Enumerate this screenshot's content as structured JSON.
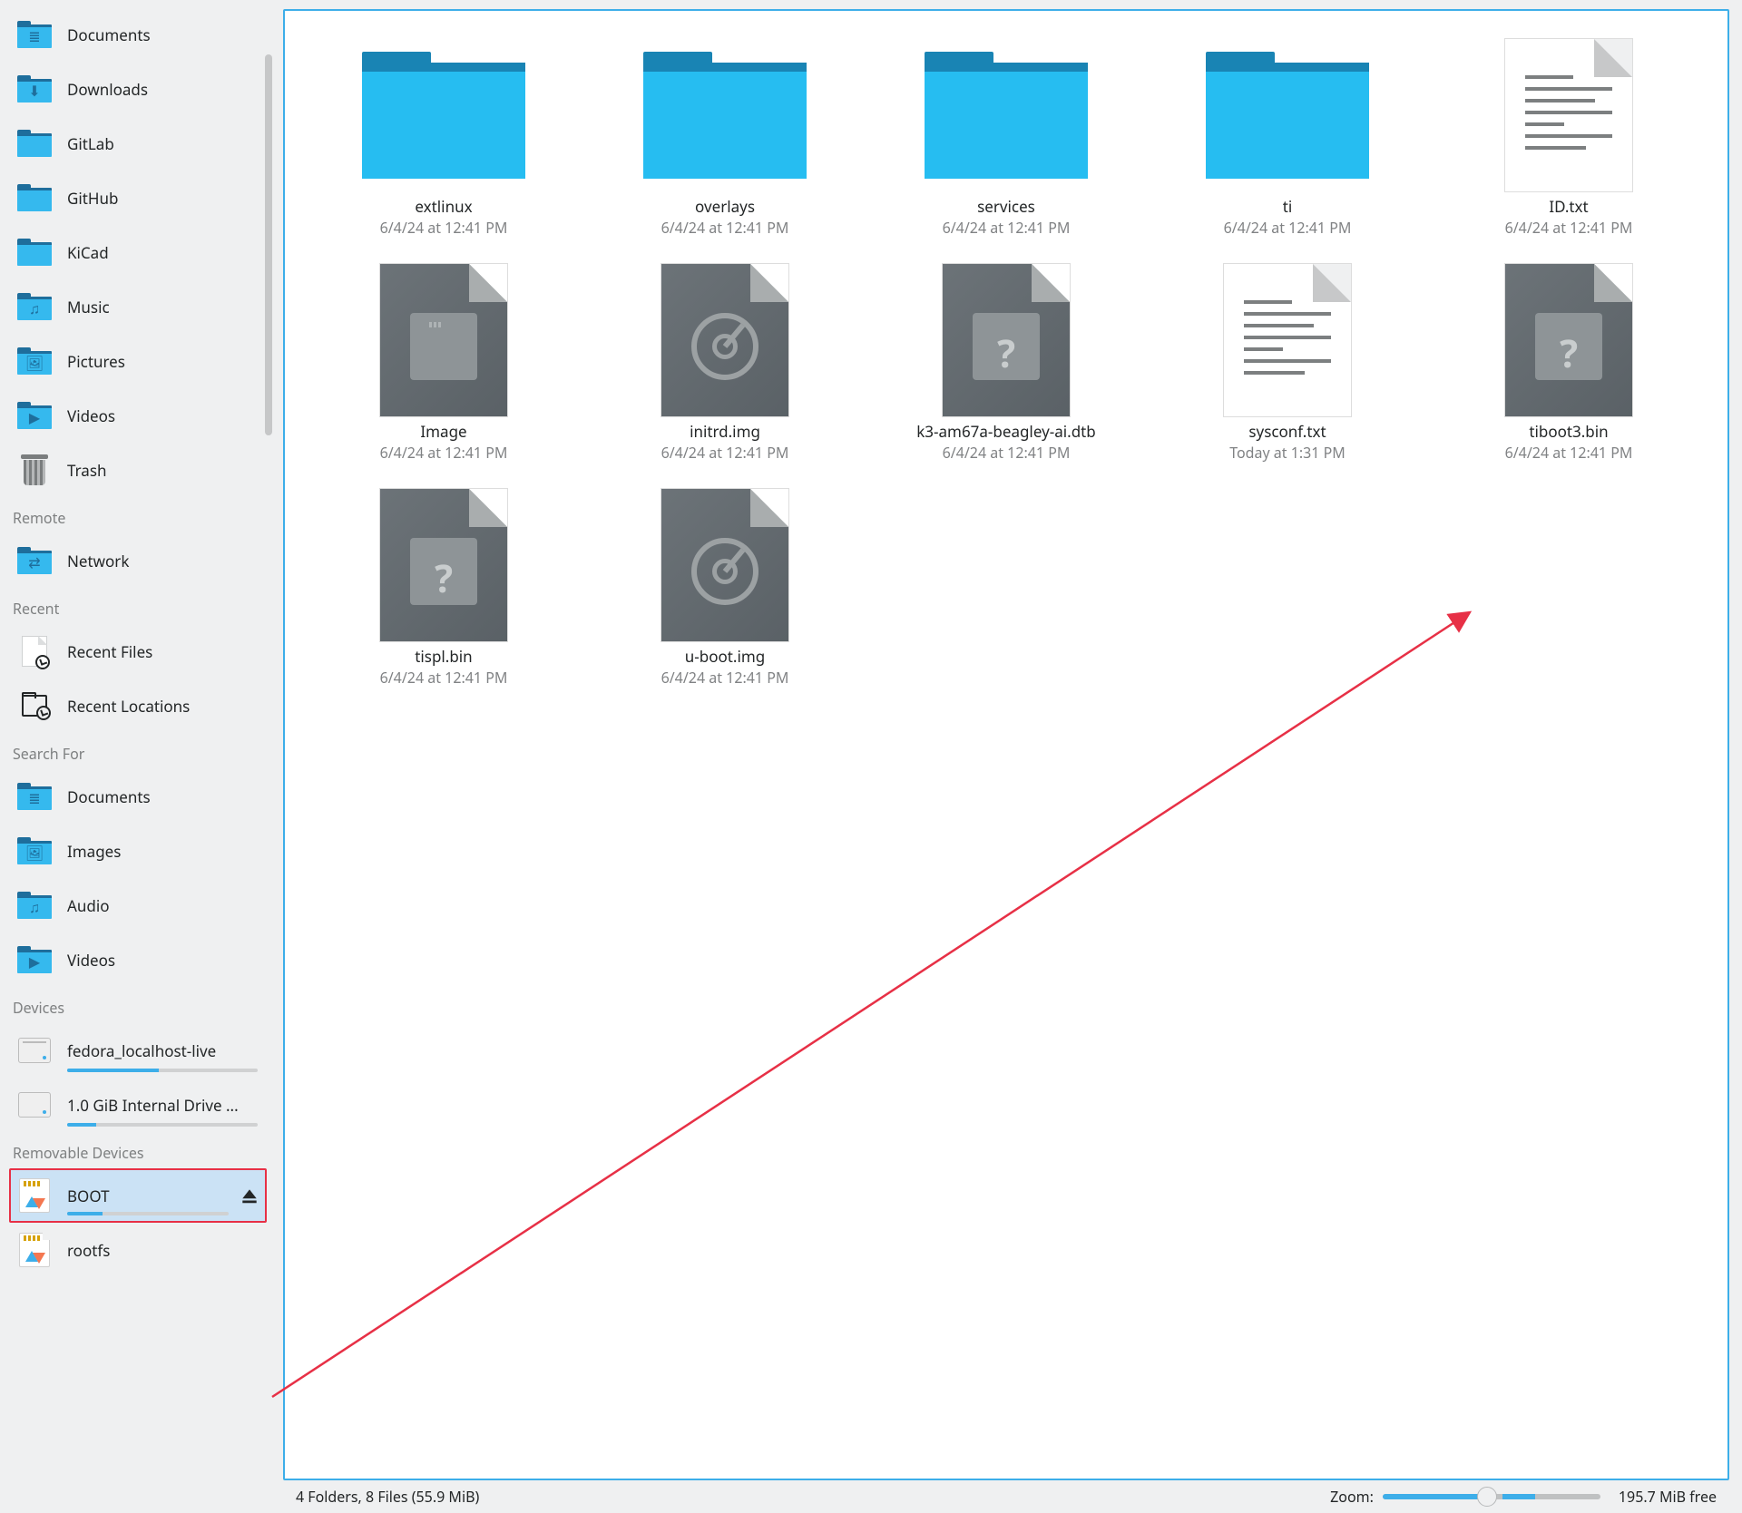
{
  "sidebar": {
    "places": [
      {
        "label": "Documents",
        "icon": "folder-documents"
      },
      {
        "label": "Downloads",
        "icon": "folder-downloads"
      },
      {
        "label": "GitLab",
        "icon": "folder"
      },
      {
        "label": "GitHub",
        "icon": "folder"
      },
      {
        "label": "KiCad",
        "icon": "folder"
      },
      {
        "label": "Music",
        "icon": "folder-music"
      },
      {
        "label": "Pictures",
        "icon": "folder-pictures"
      },
      {
        "label": "Videos",
        "icon": "folder-videos"
      },
      {
        "label": "Trash",
        "icon": "trash"
      }
    ],
    "remote_header": "Remote",
    "remote": [
      {
        "label": "Network",
        "icon": "folder-network"
      }
    ],
    "recent_header": "Recent",
    "recent": [
      {
        "label": "Recent Files",
        "icon": "recent-files"
      },
      {
        "label": "Recent Locations",
        "icon": "recent-locations"
      }
    ],
    "search_header": "Search For",
    "search": [
      {
        "label": "Documents",
        "icon": "folder-documents"
      },
      {
        "label": "Images",
        "icon": "folder-pictures"
      },
      {
        "label": "Audio",
        "icon": "folder-music"
      },
      {
        "label": "Videos",
        "icon": "folder-videos"
      }
    ],
    "devices_header": "Devices",
    "devices": [
      {
        "label": "fedora_localhost-live",
        "icon": "drive-live",
        "usage_pct": 48
      },
      {
        "label": "1.0 GiB Internal Drive ...",
        "icon": "drive",
        "usage_pct": 15
      }
    ],
    "removable_header": "Removable Devices",
    "removable": [
      {
        "label": "BOOT",
        "icon": "sd-card",
        "usage_pct": 22,
        "selected": true,
        "eject": true
      },
      {
        "label": "rootfs",
        "icon": "sd-card-corner"
      }
    ]
  },
  "files": [
    {
      "name": "extlinux",
      "date": "6/4/24 at 12:41 PM",
      "kind": "folder"
    },
    {
      "name": "overlays",
      "date": "6/4/24 at 12:41 PM",
      "kind": "folder"
    },
    {
      "name": "services",
      "date": "6/4/24 at 12:41 PM",
      "kind": "folder"
    },
    {
      "name": "ti",
      "date": "6/4/24 at 12:41 PM",
      "kind": "folder"
    },
    {
      "name": "ID.txt",
      "date": "6/4/24 at 12:41 PM",
      "kind": "txt"
    },
    {
      "name": "Image",
      "date": "6/4/24 at 12:41 PM",
      "kind": "bin-window"
    },
    {
      "name": "initrd.img",
      "date": "6/4/24 at 12:41 PM",
      "kind": "bin-disc"
    },
    {
      "name": "k3-am67a-beagley-ai.dtb",
      "date": "6/4/24 at 12:41 PM",
      "kind": "bin-question"
    },
    {
      "name": "sysconf.txt",
      "date": "Today at 1:31 PM",
      "kind": "txt"
    },
    {
      "name": "tiboot3.bin",
      "date": "6/4/24 at 12:41 PM",
      "kind": "bin-question"
    },
    {
      "name": "tispl.bin",
      "date": "6/4/24 at 12:41 PM",
      "kind": "bin-question"
    },
    {
      "name": "u-boot.img",
      "date": "6/4/24 at 12:41 PM",
      "kind": "bin-disc"
    }
  ],
  "statusbar": {
    "summary": "4 Folders, 8 Files (55.9 MiB)",
    "zoom_label": "Zoom:",
    "free_space": "195.7 MiB free"
  }
}
